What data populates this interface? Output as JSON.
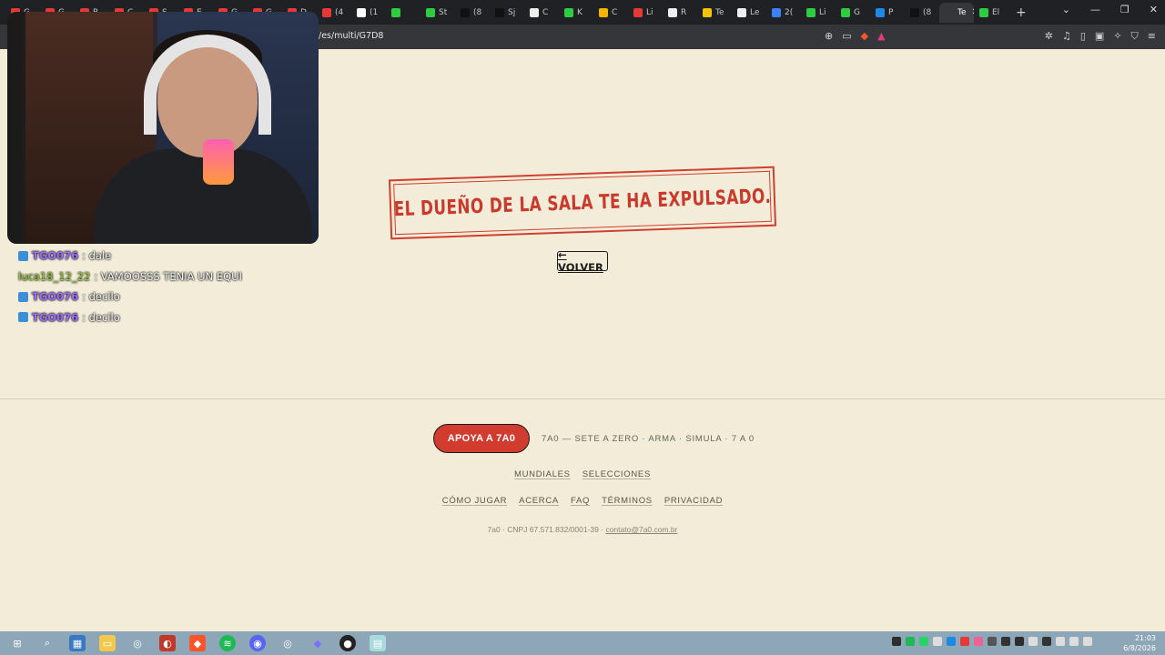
{
  "browser": {
    "tabs": [
      {
        "label": "G",
        "color": "#e53935"
      },
      {
        "label": "G",
        "color": "#e53935"
      },
      {
        "label": "R",
        "color": "#e53935"
      },
      {
        "label": "C",
        "color": "#e53935"
      },
      {
        "label": "S",
        "color": "#e53935"
      },
      {
        "label": "E",
        "color": "#e53935"
      },
      {
        "label": "G",
        "color": "#e53935"
      },
      {
        "label": "G",
        "color": "#e53935"
      },
      {
        "label": "D",
        "color": "#e53935"
      },
      {
        "label": "(4",
        "color": "#e53935"
      },
      {
        "label": "(1",
        "color": "#ffffff"
      },
      {
        "label": "",
        "color": "#2ecc40"
      },
      {
        "label": "St",
        "color": "#2ecc40"
      },
      {
        "label": "(8",
        "color": "#111111"
      },
      {
        "label": "Sj",
        "color": "#111111"
      },
      {
        "label": "C",
        "color": "#eeeeee"
      },
      {
        "label": "K",
        "color": "#2ecc40"
      },
      {
        "label": "C",
        "color": "#f4b400"
      },
      {
        "label": "Li",
        "color": "#e53935"
      },
      {
        "label": "R",
        "color": "#eeeeee"
      },
      {
        "label": "Te",
        "color": "#f4c20d"
      },
      {
        "label": "Le",
        "color": "#eeeeee"
      },
      {
        "label": "2(",
        "color": "#3b82f6"
      },
      {
        "label": "Li",
        "color": "#2ecc40"
      },
      {
        "label": "G",
        "color": "#2ecc40"
      },
      {
        "label": "P",
        "color": "#1e88e5"
      },
      {
        "label": "(8",
        "color": "#111111"
      },
      {
        "label": "Te",
        "color": "#35363a"
      },
      {
        "label": "El",
        "color": "#2ecc40"
      }
    ],
    "active_tab_close": "✕",
    "new_tab": "+",
    "url": "/es/multi/G7D8",
    "window_controls": [
      "⌄",
      "—",
      "❐",
      "✕"
    ]
  },
  "chat": [
    {
      "user": "TGO076",
      "message": ": dale",
      "badge": true,
      "user_color": "purple"
    },
    {
      "user": "luca18_12_22",
      "message": ": VAMOOSSS TENIA UN EQUI",
      "badge": false,
      "user_color": "green"
    },
    {
      "user": "TGO076",
      "message": ": decilo",
      "badge": true,
      "user_color": "purple"
    },
    {
      "user": "TGO076",
      "message": ": decilo",
      "badge": true,
      "user_color": "purple"
    }
  ],
  "main": {
    "stamp_text": "EL DUEÑO DE LA SALA TE HA EXPULSADO.",
    "back_label": "← VOLVER"
  },
  "footer": {
    "support_label": "APOYA A 7A0",
    "tagline": "7A0 — SETE A ZERO · ARMA · SIMULA · 7 A 0",
    "links_row1": [
      "MUNDIALES",
      "SELECCIONES"
    ],
    "links_row2": [
      "CÓMO JUGAR",
      "ACERCA",
      "FAQ",
      "TÉRMINOS",
      "PRIVACIDAD"
    ],
    "legal_prefix": "7a0 · CNPJ 67.571.832/0001-39 ·",
    "legal_email": "contato@7a0.com.br"
  },
  "taskbar": {
    "time": "21:03",
    "date": "6/8/2026"
  },
  "colors": {
    "page_bg": "#f2ecd9",
    "accent_red": "#d23c2e",
    "stamp_red": "#c93a2c"
  }
}
